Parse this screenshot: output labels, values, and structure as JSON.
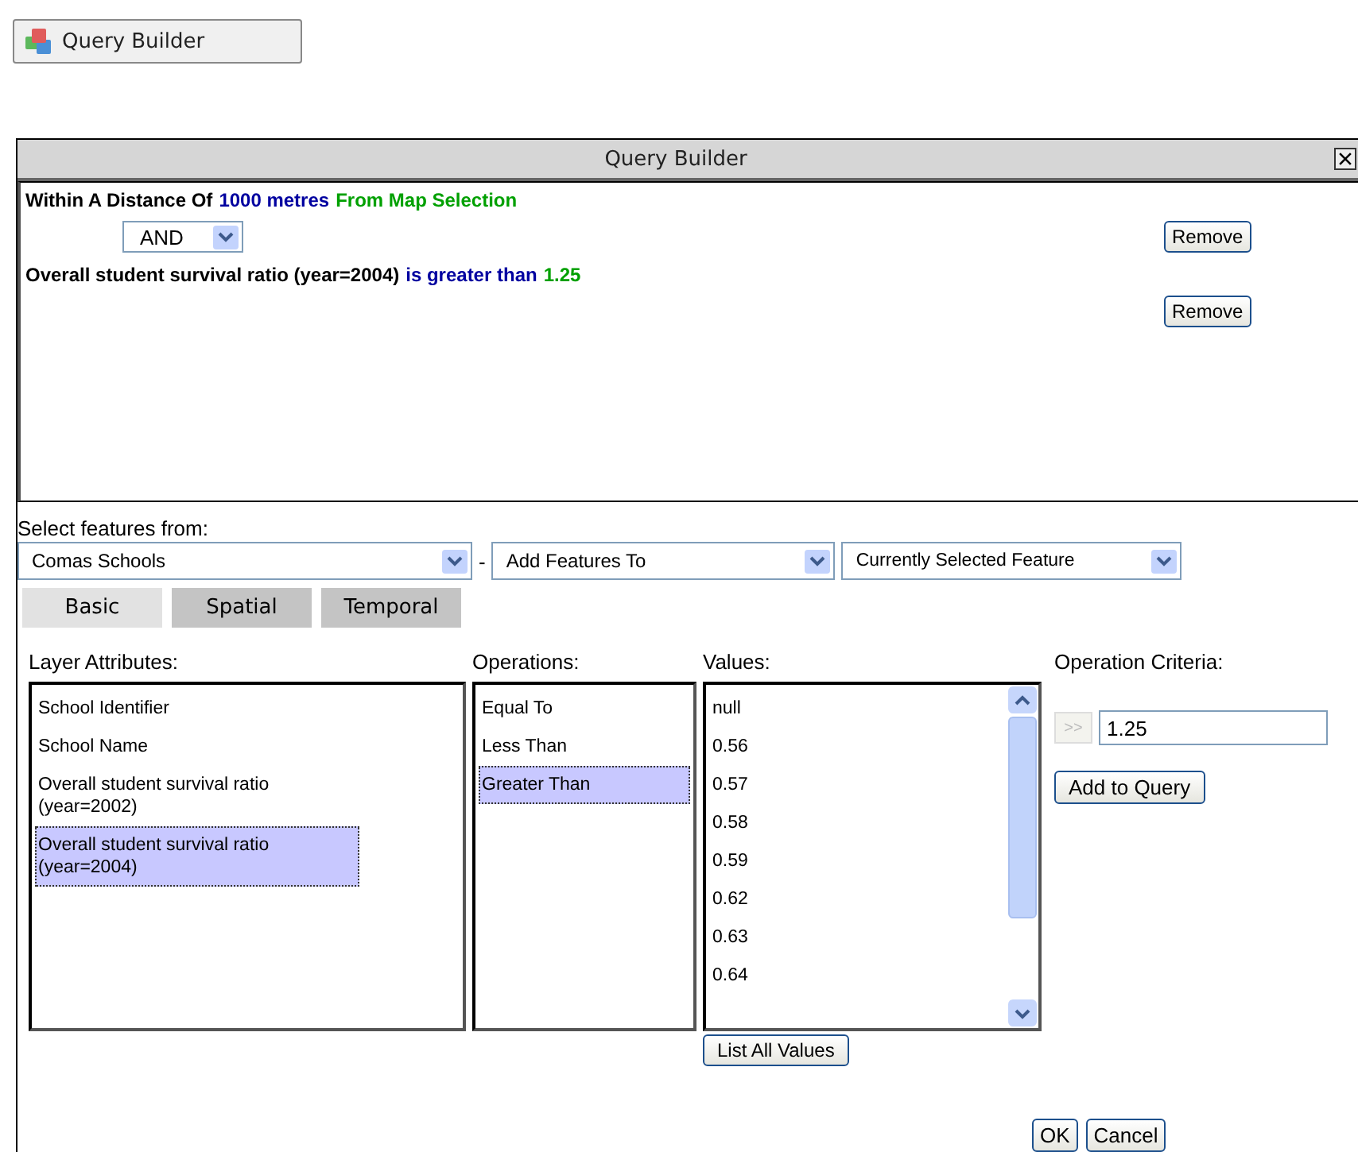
{
  "launcher": {
    "label": "Query Builder"
  },
  "dialog": {
    "title": "Query Builder",
    "conditions": [
      {
        "parts": [
          {
            "text": "Within A Distance Of",
            "color": "#000000"
          },
          {
            "text": "1000 metres",
            "color": "#0000a0"
          },
          {
            "text": "From Map Selection",
            "color": "#00a000"
          }
        ],
        "remove": "Remove"
      },
      {
        "joiner": "AND",
        "parts": [
          {
            "text": "Overall student survival ratio (year=2004)",
            "color": "#000000"
          },
          {
            "text": "is greater than",
            "color": "#0000a0"
          },
          {
            "text": "1.25",
            "color": "#00a000"
          }
        ],
        "remove": "Remove"
      }
    ],
    "select_label": "Select features from:",
    "layer_select": "Comas Schools",
    "separator": "-",
    "action_select": "Add Features To",
    "target_select": "Currently Selected Feature",
    "tabs": [
      {
        "label": "Basic",
        "selected": true
      },
      {
        "label": "Spatial",
        "selected": false
      },
      {
        "label": "Temporal",
        "selected": false
      }
    ],
    "layer_attributes": {
      "label": "Layer Attributes:",
      "items": [
        {
          "text": "School Identifier",
          "selected": false
        },
        {
          "text": "School Name",
          "selected": false
        },
        {
          "text": "Overall student survival ratio (year=2002)",
          "selected": false
        },
        {
          "text": "Overall student survival ratio (year=2004)",
          "selected": true
        }
      ]
    },
    "operations": {
      "label": "Operations:",
      "items": [
        {
          "text": "Equal To",
          "selected": false
        },
        {
          "text": "Less Than",
          "selected": false
        },
        {
          "text": "Greater Than",
          "selected": true
        }
      ]
    },
    "values": {
      "label": "Values:",
      "items": [
        "null",
        "0.56",
        "0.57",
        "0.58",
        "0.59",
        "0.62",
        "0.63",
        "0.64"
      ],
      "list_all": "List All Values"
    },
    "criteria": {
      "label": "Operation Criteria:",
      "transfer": ">>",
      "value": "1.25",
      "add": "Add to Query"
    },
    "buttons": [
      "OK",
      "Cancel"
    ]
  }
}
